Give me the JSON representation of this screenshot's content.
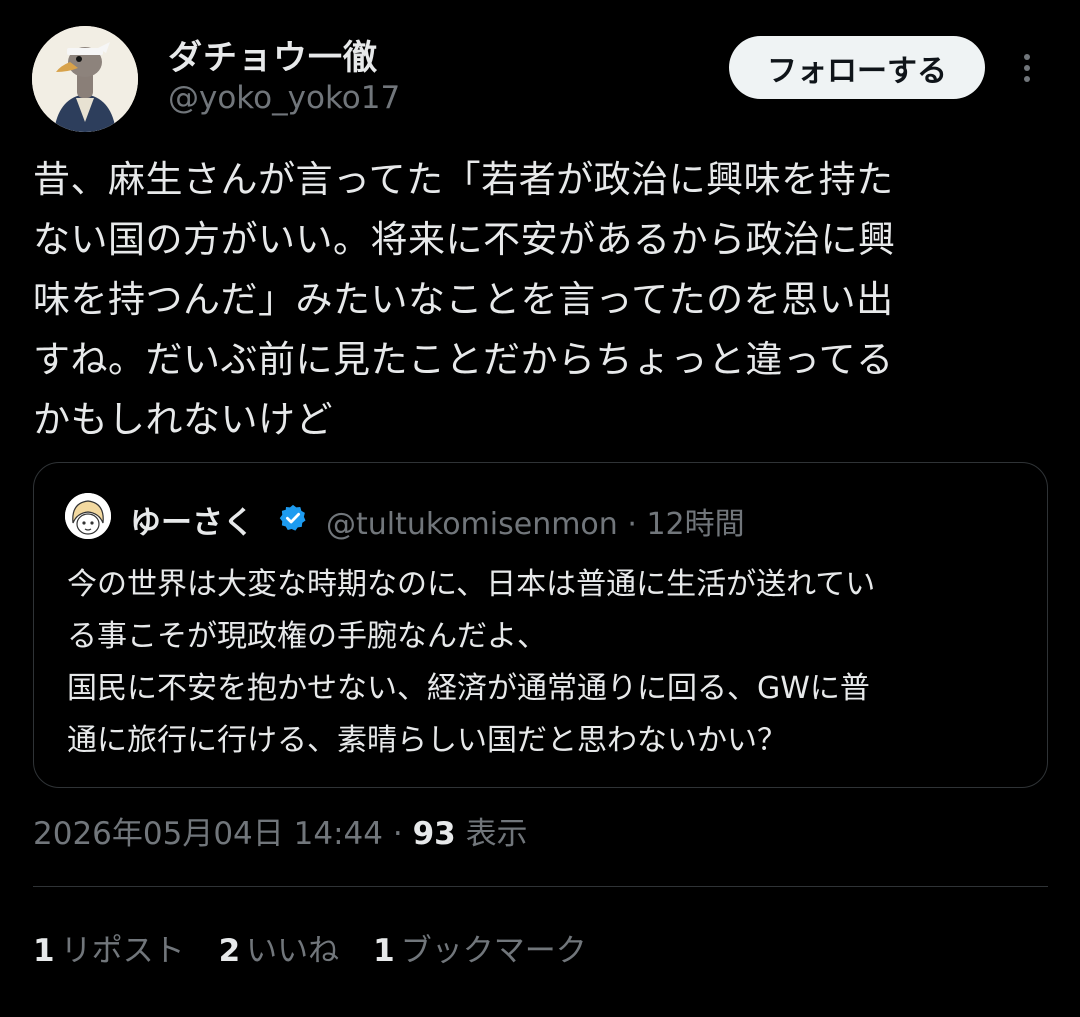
{
  "author": {
    "display_name": "ダチョウ一徹",
    "handle": "@yoko_yoko17"
  },
  "follow_button": {
    "label": "フォローする"
  },
  "more_icon": "more-vertical-icon",
  "tweet": {
    "text": "昔、麻生さんが言ってた「若者が政治に興味を持た\nない国の方がいい。将来に不安があるから政治に興\n味を持つんだ」みたいなことを言ってたのを思い出\nすね。だいぶ前に見たことだからちょっと違ってる\nかもしれないけど"
  },
  "quote": {
    "display_name": "ゆーさく",
    "verified_icon": "verified-badge-icon",
    "handle": "@tultukomisenmon",
    "separator": "·",
    "time": "12時間",
    "text": "今の世界は大変な時期なのに、日本は普通に生活が送れてい\nる事こそが現政権の手腕なんだよ、\n国民に不安を抱かせない、経済が通常通りに回る、GWに普\n通に旅行に行ける、素晴らしい国だと思わないかい？"
  },
  "meta": {
    "timestamp": "2026年05月04日 14:44",
    "separator": "·",
    "views_count": "93",
    "views_label": "表示"
  },
  "stats": {
    "reposts_count": "1",
    "reposts_label": "リポスト",
    "likes_count": "2",
    "likes_label": "いいね",
    "bookmarks_count": "1",
    "bookmarks_label": "ブックマーク"
  },
  "colors": {
    "background": "#000000",
    "text_primary": "#e7e9ea",
    "text_secondary": "#71767b",
    "border": "#2f3336",
    "verified": "#1d9bf0",
    "button_bg": "#eff3f4"
  }
}
